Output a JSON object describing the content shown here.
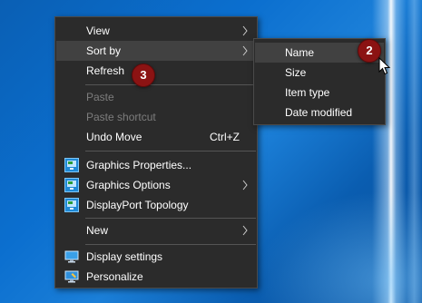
{
  "main_menu": {
    "items": [
      {
        "label": "View",
        "submenu": true
      },
      {
        "label": "Sort by",
        "submenu": true
      },
      {
        "label": "Refresh"
      },
      {
        "label": "Paste",
        "disabled": true
      },
      {
        "label": "Paste shortcut",
        "disabled": true
      },
      {
        "label": "Undo Move",
        "shortcut": "Ctrl+Z"
      },
      {
        "label": "Graphics Properties...",
        "icon": "intel-graphics-icon"
      },
      {
        "label": "Graphics Options",
        "icon": "intel-graphics-icon",
        "submenu": true
      },
      {
        "label": "DisplayPort Topology",
        "icon": "intel-graphics-icon"
      },
      {
        "label": "New",
        "submenu": true
      },
      {
        "label": "Display settings",
        "icon": "display-icon"
      },
      {
        "label": "Personalize",
        "icon": "personalize-icon"
      }
    ]
  },
  "sort_submenu": {
    "items": [
      {
        "label": "Name"
      },
      {
        "label": "Size"
      },
      {
        "label": "Item type"
      },
      {
        "label": "Date modified"
      }
    ]
  },
  "badges": {
    "sort_name": "2",
    "refresh": "3"
  },
  "colors": {
    "menu_bg": "#2b2b2b",
    "highlight": "#414141",
    "badge": "#8b1313",
    "disabled_text": "#7d7d7d"
  }
}
